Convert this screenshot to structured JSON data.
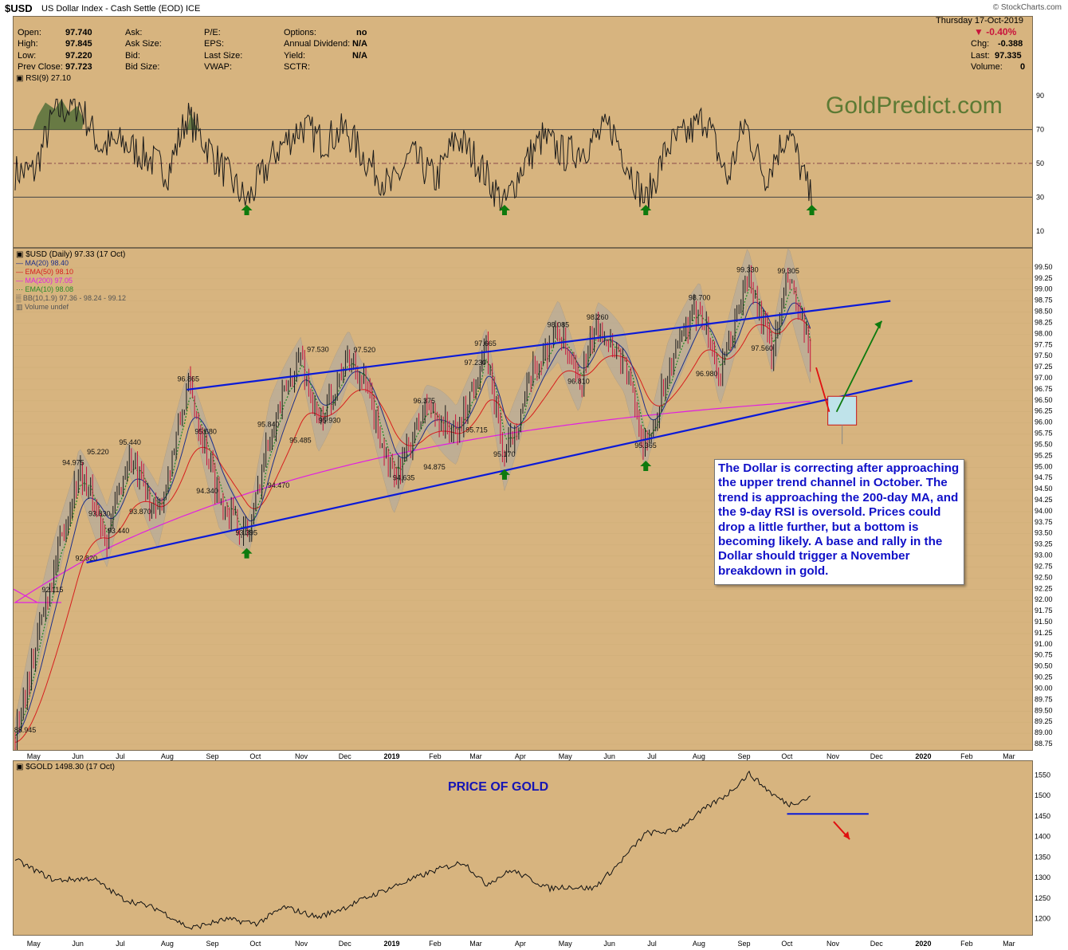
{
  "header": {
    "symbol": "$USD",
    "description": "US Dollar Index - Cash Settle (EOD) ICE",
    "source": "© StockCharts.com"
  },
  "quote": {
    "date": "Thursday  17-Oct-2019",
    "change_pct": "-0.40%",
    "chg_label": "Chg:",
    "chg": "-0.388",
    "last_label": "Last:",
    "last": "97.335",
    "volume_label": "Volume:",
    "volume": "0",
    "open_label": "Open:",
    "open": "97.740",
    "high_label": "High:",
    "high": "97.845",
    "low_label": "Low:",
    "low": "97.220",
    "prev_label": "Prev Close:",
    "prev": "97.723",
    "ask_label": "Ask:",
    "asksize_label": "Ask Size:",
    "bid_label": "Bid:",
    "bidsize_label": "Bid Size:",
    "pe_label": "P/E:",
    "eps_label": "EPS:",
    "lastsize_label": "Last Size:",
    "vwap_label": "VWAP:",
    "options_label": "Options:",
    "options": "no",
    "divid_label": "Annual Dividend:",
    "divid": "N/A",
    "yield_label": "Yield:",
    "yield": "N/A",
    "sctr_label": "SCTR:"
  },
  "watermark": "GoldPredict.com",
  "rsi_legend": "RSI(9) 27.10",
  "main_legend": {
    "title": "$USD (Daily) 97.33 (17 Oct)",
    "ma20": "MA(20) 98.40",
    "ema50": "EMA(50) 98.10",
    "ma200": "MA(200) 97.05",
    "ema10": "EMA(10) 98.08",
    "bb": "BB(10,1.9) 97.36 - 98.24 - 99.12",
    "volume": "Volume undef"
  },
  "gold_legend": "$GOLD 1498.30 (17 Oct)",
  "gold_title": "PRICE OF GOLD",
  "annotation": "The Dollar is correcting after approaching the upper trend channel in October. The trend is approaching the 200-day MA, and the 9-day RSI is oversold. Prices could drop a little further, but a bottom is becoming likely. A base and rally in the Dollar should trigger a November breakdown in gold.",
  "colors": {
    "panel_bg": "#d7b47f",
    "price_up": "#1a1a1a",
    "price_down": "#c8143c",
    "channel": "#0a1ad8",
    "ma20": "#1c2e8a",
    "ema50": "#d61e1e",
    "ma200": "#e020e0",
    "ema10": "#2a8a2a",
    "bands": "#a9a9a9",
    "arrow": "#0e7a0e",
    "note_text": "#1010c8"
  },
  "chart_data": [
    {
      "type": "line",
      "name": "RSI(9)",
      "y_ticks": [
        10,
        30,
        50,
        70,
        90
      ],
      "ylim": [
        0,
        100
      ],
      "reference_lines": [
        30,
        50,
        70
      ],
      "x": [
        "2018-05-01",
        "2018-05-15",
        "2018-06-01",
        "2018-06-15",
        "2018-07-01",
        "2018-07-15",
        "2018-08-01",
        "2018-08-14",
        "2018-09-01",
        "2018-09-24",
        "2018-10-15",
        "2018-11-01",
        "2018-11-15",
        "2018-12-01",
        "2018-12-15",
        "2019-01-01",
        "2019-01-15",
        "2019-02-01",
        "2019-02-15",
        "2019-03-01",
        "2019-03-20",
        "2019-04-01",
        "2019-04-15",
        "2019-05-01",
        "2019-05-15",
        "2019-06-01",
        "2019-06-15",
        "2019-06-25",
        "2019-07-10",
        "2019-07-25",
        "2019-08-05",
        "2019-08-20",
        "2019-09-01",
        "2019-09-15",
        "2019-10-01",
        "2019-10-17"
      ],
      "values": [
        45,
        80,
        85,
        60,
        62,
        55,
        45,
        78,
        55,
        27,
        58,
        72,
        63,
        70,
        52,
        35,
        55,
        40,
        66,
        52,
        25,
        48,
        65,
        55,
        60,
        72,
        45,
        27,
        60,
        68,
        78,
        40,
        74,
        42,
        70,
        27
      ],
      "annotations": [
        "oversold arrow near 2018-09-24",
        "oversold arrow near 2019-03-20",
        "oversold arrow near 2019-06-25",
        "oversold arrow near 2019-10-17"
      ]
    },
    {
      "type": "line",
      "name": "$USD",
      "y_ticks": [
        88.75,
        89.0,
        89.25,
        89.5,
        89.75,
        90.0,
        90.25,
        90.5,
        90.75,
        91.0,
        91.25,
        91.5,
        91.75,
        92.0,
        92.25,
        92.5,
        92.75,
        93.0,
        93.25,
        93.5,
        93.75,
        94.0,
        94.25,
        94.5,
        94.75,
        95.0,
        95.25,
        95.5,
        95.75,
        96.0,
        96.25,
        96.5,
        96.75,
        97.0,
        97.25,
        97.5,
        97.75,
        98.0,
        98.25,
        98.5,
        98.75,
        99.0,
        99.25,
        99.5
      ],
      "x_labels": [
        "May",
        "Jun",
        "Jul",
        "Aug",
        "Sep",
        "Oct",
        "Nov",
        "Dec",
        "2019",
        "Feb",
        "Mar",
        "Apr",
        "May",
        "Jun",
        "Jul",
        "Aug",
        "Sep",
        "Oct",
        "Nov",
        "Dec",
        "2020",
        "Feb",
        "Mar"
      ],
      "ylim": [
        88.75,
        99.75
      ],
      "x": [
        "2018-04-18",
        "2018-05-10",
        "2018-06-01",
        "2018-06-20",
        "2018-07-05",
        "2018-07-25",
        "2018-08-15",
        "2018-09-05",
        "2018-09-25",
        "2018-10-10",
        "2018-10-31",
        "2018-11-12",
        "2018-12-03",
        "2018-12-14",
        "2019-01-03",
        "2019-01-25",
        "2019-02-15",
        "2019-03-07",
        "2019-03-20",
        "2019-04-10",
        "2019-04-26",
        "2019-05-10",
        "2019-05-23",
        "2019-06-10",
        "2019-06-25",
        "2019-07-10",
        "2019-08-01",
        "2019-08-15",
        "2019-09-03",
        "2019-09-20",
        "2019-10-01",
        "2019-10-17"
      ],
      "series": [
        {
          "values": [
            88.945,
            92.115,
            94.975,
            93.44,
            95.22,
            93.87,
            96.865,
            94.34,
            93.395,
            95.84,
            97.53,
            95.93,
            97.52,
            96.9,
            94.635,
            96.375,
            95.715,
            97.665,
            95.17,
            97.23,
            98.085,
            96.81,
            98.26,
            97.4,
            95.365,
            97.15,
            98.7,
            96.98,
            99.33,
            97.56,
            99.305,
            97.335
          ]
        }
      ],
      "labeled_points": [
        {
          "x": "2018-04-25",
          "y": 88.945
        },
        {
          "x": "2018-05-14",
          "y": 92.115
        },
        {
          "x": "2018-06-06",
          "y": 92.82
        },
        {
          "x": "2018-05-28",
          "y": 94.975
        },
        {
          "x": "2018-06-14",
          "y": 95.22
        },
        {
          "x": "2018-06-15",
          "y": 93.83
        },
        {
          "x": "2018-06-28",
          "y": 93.44
        },
        {
          "x": "2018-07-06",
          "y": 95.44
        },
        {
          "x": "2018-07-13",
          "y": 93.87
        },
        {
          "x": "2018-08-15",
          "y": 96.865
        },
        {
          "x": "2018-08-27",
          "y": 95.68
        },
        {
          "x": "2018-08-28",
          "y": 94.34
        },
        {
          "x": "2018-09-24",
          "y": 93.395
        },
        {
          "x": "2018-10-09",
          "y": 95.84
        },
        {
          "x": "2018-10-16",
          "y": 94.47
        },
        {
          "x": "2018-10-31",
          "y": 95.485
        },
        {
          "x": "2018-11-12",
          "y": 97.53
        },
        {
          "x": "2018-11-20",
          "y": 95.93
        },
        {
          "x": "2018-12-14",
          "y": 97.52
        },
        {
          "x": "2019-01-10",
          "y": 94.635
        },
        {
          "x": "2019-01-24",
          "y": 96.375
        },
        {
          "x": "2019-01-31",
          "y": 94.875
        },
        {
          "x": "2019-02-28",
          "y": 97.23
        },
        {
          "x": "2019-03-07",
          "y": 97.665
        },
        {
          "x": "2019-03-01",
          "y": 95.715
        },
        {
          "x": "2019-03-20",
          "y": 95.17
        },
        {
          "x": "2019-04-26",
          "y": 98.085
        },
        {
          "x": "2019-05-10",
          "y": 96.81
        },
        {
          "x": "2019-05-23",
          "y": 98.26
        },
        {
          "x": "2019-06-25",
          "y": 95.365
        },
        {
          "x": "2019-08-01",
          "y": 98.7
        },
        {
          "x": "2019-08-06",
          "y": 96.98
        },
        {
          "x": "2019-09-03",
          "y": 99.33
        },
        {
          "x": "2019-09-13",
          "y": 97.56
        },
        {
          "x": "2019-10-01",
          "y": 99.305
        }
      ],
      "trendlines": [
        {
          "name": "upper channel",
          "x": [
            "2018-08-14",
            "2019-12-10"
          ],
          "y": [
            96.75,
            98.75
          ]
        },
        {
          "name": "lower channel",
          "x": [
            "2018-06-06",
            "2019-12-25"
          ],
          "y": [
            92.85,
            96.95
          ]
        }
      ]
    },
    {
      "type": "line",
      "name": "$GOLD",
      "y_ticks": [
        1200,
        1250,
        1300,
        1350,
        1400,
        1450,
        1500,
        1550
      ],
      "x_labels": [
        "May",
        "Jun",
        "Jul",
        "Aug",
        "Sep",
        "Oct",
        "Nov",
        "Dec",
        "2019",
        "Feb",
        "Mar",
        "Apr",
        "May",
        "Jun",
        "Jul",
        "Aug",
        "Sep",
        "Oct",
        "Nov",
        "Dec",
        "2020",
        "Feb",
        "Mar"
      ],
      "ylim": [
        1170,
        1570
      ],
      "x": [
        "2018-04-18",
        "2018-05-15",
        "2018-06-10",
        "2018-07-01",
        "2018-07-25",
        "2018-08-16",
        "2018-09-10",
        "2018-10-01",
        "2018-10-20",
        "2018-11-12",
        "2018-12-01",
        "2018-12-20",
        "2019-01-10",
        "2019-02-01",
        "2019-02-20",
        "2019-03-07",
        "2019-03-25",
        "2019-04-20",
        "2019-05-01",
        "2019-05-20",
        "2019-06-05",
        "2019-06-25",
        "2019-07-15",
        "2019-08-05",
        "2019-08-20",
        "2019-09-04",
        "2019-09-20",
        "2019-10-01",
        "2019-10-17"
      ],
      "values": [
        1345,
        1295,
        1300,
        1250,
        1225,
        1178,
        1200,
        1190,
        1230,
        1205,
        1230,
        1260,
        1290,
        1320,
        1340,
        1285,
        1320,
        1275,
        1280,
        1275,
        1330,
        1410,
        1415,
        1470,
        1505,
        1555,
        1505,
        1480,
        1498
      ],
      "annotations": [
        "horizontal line at ~1457 from Oct to Nov 2019",
        "red arrow pointing down"
      ]
    }
  ]
}
